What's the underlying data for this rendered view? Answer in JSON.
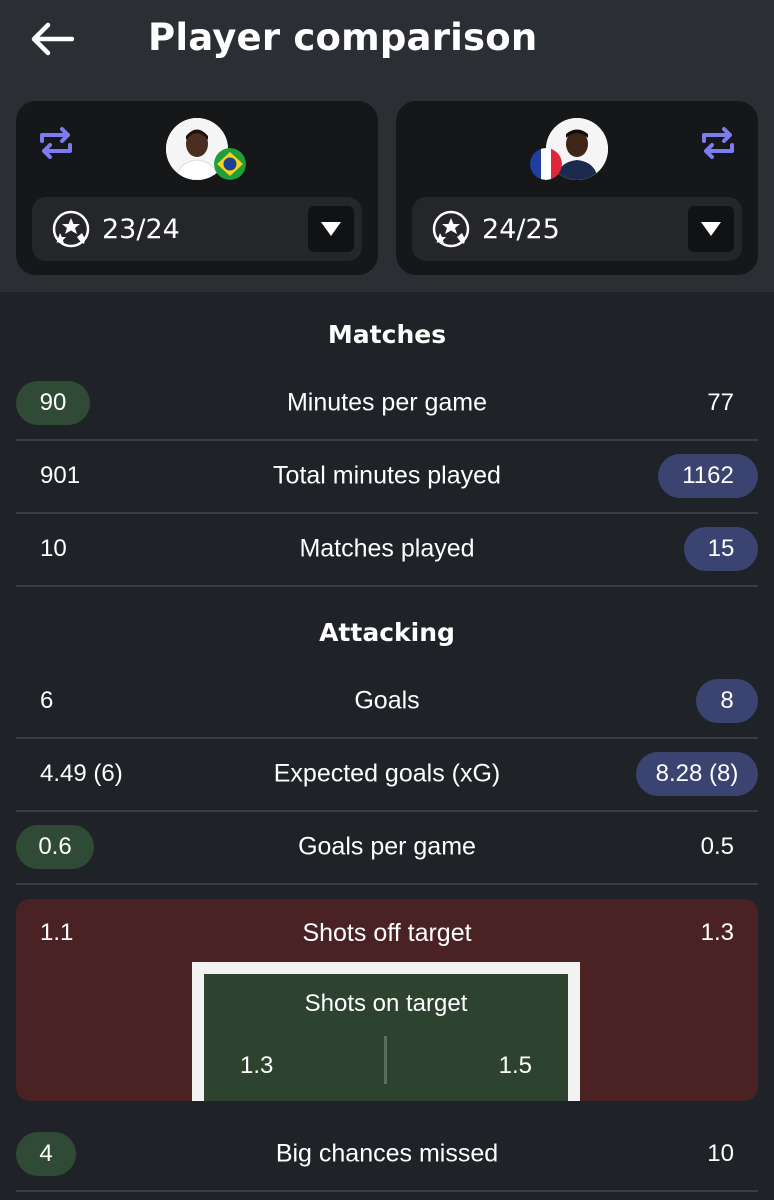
{
  "header": {
    "title": "Player comparison"
  },
  "players": {
    "left": {
      "season": "23/24",
      "flag": "brazil-flag"
    },
    "right": {
      "season": "24/25",
      "flag": "france-flag"
    }
  },
  "colors": {
    "better_left": "#2f4b35",
    "better_right": "#3b4370",
    "shots_box": "#4a2224",
    "accent_swap": "#7c7cf0"
  },
  "sections": {
    "matches": {
      "title": "Matches",
      "rows": [
        {
          "label": "Minutes per game",
          "left": "90",
          "right": "77",
          "highlight": "left"
        },
        {
          "label": "Total minutes played",
          "left": "901",
          "right": "1162",
          "highlight": "right"
        },
        {
          "label": "Matches played",
          "left": "10",
          "right": "15",
          "highlight": "right"
        }
      ]
    },
    "attacking": {
      "title": "Attacking",
      "rows": [
        {
          "label": "Goals",
          "left": "6",
          "right": "8",
          "highlight": "right"
        },
        {
          "label": "Expected goals (xG)",
          "left": "4.49 (6)",
          "right": "8.28 (8)",
          "highlight": "right"
        },
        {
          "label": "Goals per game",
          "left": "0.6",
          "right": "0.5",
          "highlight": "left"
        }
      ],
      "shots": {
        "off_label": "Shots off target",
        "off_left": "1.1",
        "off_right": "1.3",
        "on_label": "Shots on target",
        "on_left": "1.3",
        "on_right": "1.5"
      },
      "big_chances": {
        "label": "Big chances missed",
        "left": "4",
        "right": "10",
        "highlight": "left"
      }
    }
  }
}
